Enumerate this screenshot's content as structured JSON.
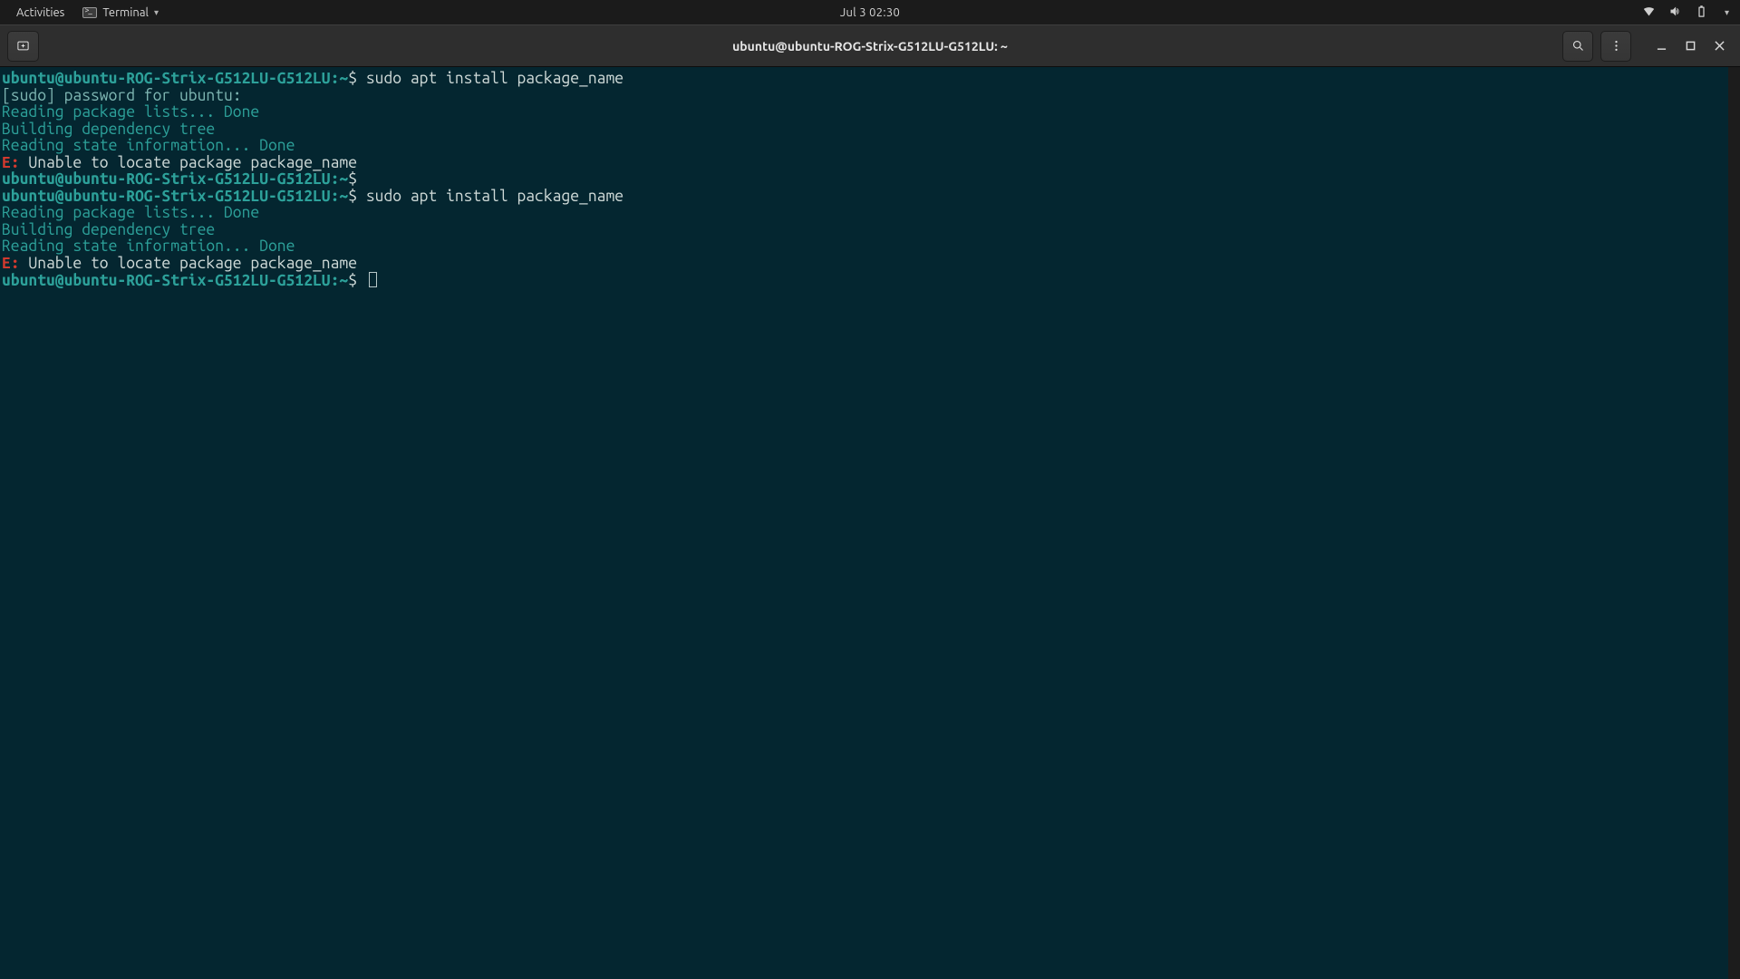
{
  "gnome": {
    "activities": "Activities",
    "app_name": "Terminal",
    "clock": "Jul 3  02:30"
  },
  "titlebar": {
    "title": "ubuntu@ubuntu-ROG-Strix-G512LU-G512LU: ~"
  },
  "colors": {
    "term_bg": "#042630",
    "prompt": "#2da19a",
    "error": "#d33a2f"
  },
  "session": {
    "prompt_user": "ubuntu@ubuntu-ROG-Strix-G512LU-G512LU",
    "prompt_path": "~",
    "prompt_symbol": "$",
    "lines": [
      {
        "t": "prompt",
        "cmd": "sudo apt install package_name"
      },
      {
        "t": "dim",
        "text": "[sudo] password for ubuntu: "
      },
      {
        "t": "teal",
        "text": "Reading package lists... Done"
      },
      {
        "t": "teal",
        "text": "Building dependency tree       "
      },
      {
        "t": "teal",
        "text": "Reading state information... Done"
      },
      {
        "t": "err",
        "code": "E:",
        "text": " Unable to locate package package_name"
      },
      {
        "t": "prompt",
        "cmd": ""
      },
      {
        "t": "prompt",
        "cmd": "sudo apt install package_name"
      },
      {
        "t": "teal",
        "text": "Reading package lists... Done"
      },
      {
        "t": "teal",
        "text": "Building dependency tree       "
      },
      {
        "t": "teal",
        "text": "Reading state information... Done"
      },
      {
        "t": "err",
        "code": "E:",
        "text": " Unable to locate package package_name"
      },
      {
        "t": "prompt-cursor"
      }
    ]
  }
}
